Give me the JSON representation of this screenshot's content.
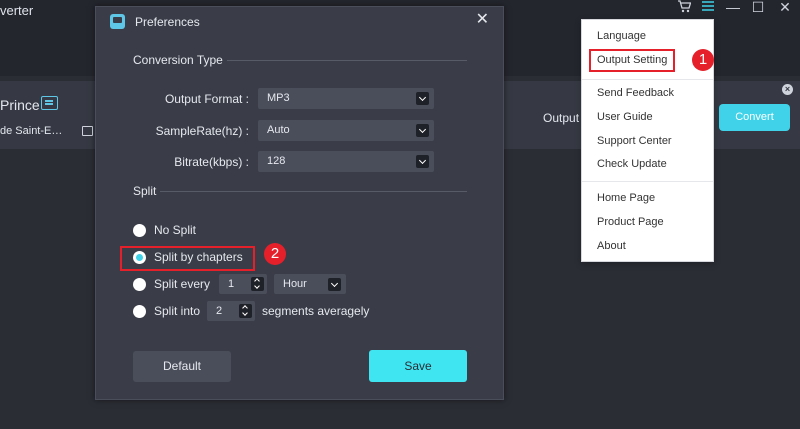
{
  "app": {
    "title_fragment": "verter",
    "book_title_fragment": "Prince",
    "book_author_fragment": "de Saint-E…",
    "output_label": "Output",
    "convert_label": "Convert",
    "row_close": "×"
  },
  "window_controls": {
    "minimize": "—",
    "maximize": "☐",
    "close": "✕"
  },
  "dialog": {
    "title": "Preferences",
    "close": "✕",
    "conversion_section": "Conversion Type",
    "output_format_label": "Output Format :",
    "output_format_value": "MP3",
    "samplerate_label": "SampleRate(hz) :",
    "samplerate_value": "Auto",
    "bitrate_label": "Bitrate(kbps) :",
    "bitrate_value": "128",
    "split_section": "Split",
    "split_options": {
      "no_split": "No Split",
      "by_chapters": "Split by chapters",
      "every": "Split every",
      "every_value": "1",
      "every_unit": "Hour",
      "into": "Split into",
      "into_value": "2",
      "into_suffix": "segments averagely"
    },
    "selected_option": "by_chapters",
    "default_button": "Default",
    "save_button": "Save"
  },
  "menu": {
    "items": [
      "Language",
      "Output Setting",
      "Send Feedback",
      "User Guide",
      "Support Center",
      "Check Update",
      "Home Page",
      "Product Page",
      "About"
    ]
  },
  "annotations": {
    "badge_1": "1",
    "badge_2": "2"
  },
  "colors": {
    "accent": "#3fd2e8",
    "highlight": "#e5202b",
    "dialog_bg": "#3a3d48",
    "app_bg": "#2b2d35"
  }
}
